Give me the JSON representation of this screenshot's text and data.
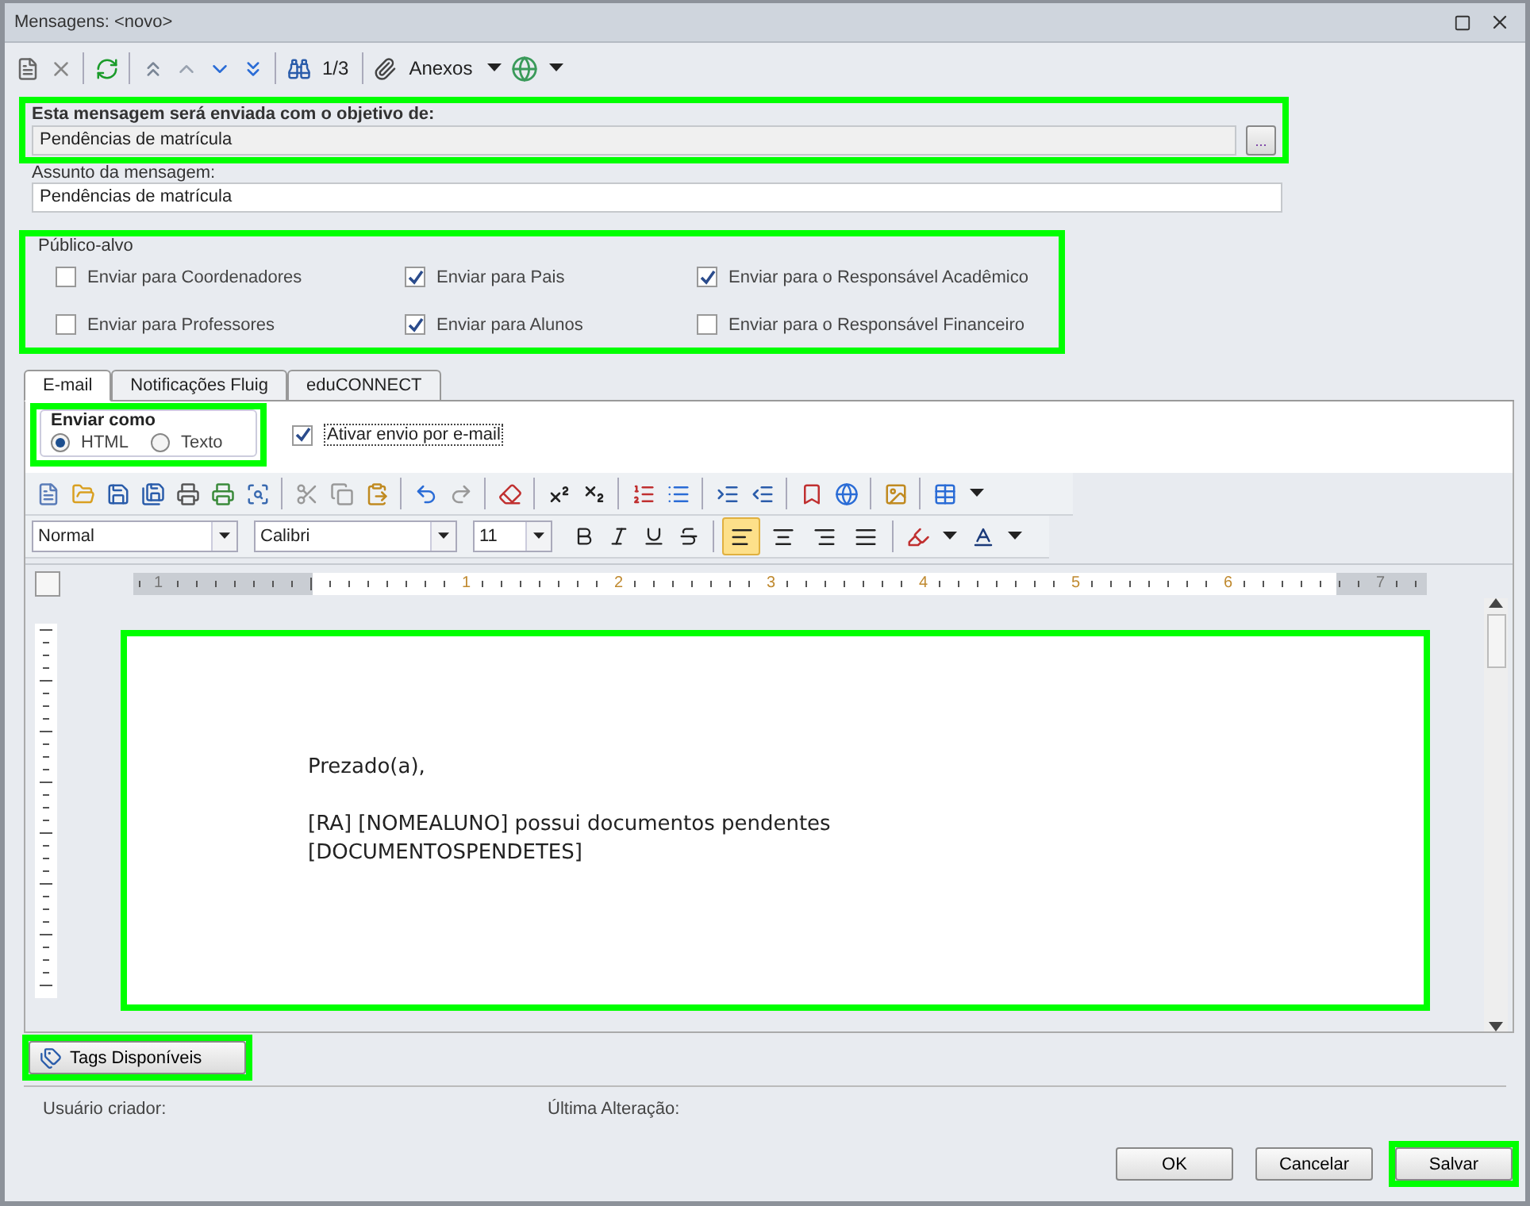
{
  "window": {
    "title": "Mensagens: <novo>"
  },
  "toolbar": {
    "record_position": "1/3",
    "attachments_label": "Anexos"
  },
  "purpose": {
    "highlighted": true,
    "label": "Esta mensagem será enviada com o objetivo de:",
    "value": "Pendências de matrícula",
    "browse_label": "..."
  },
  "subject": {
    "label": "Assunto da mensagem:",
    "value": "Pendências de matrícula"
  },
  "audience": {
    "highlighted": true,
    "title": "Público-alvo",
    "options": [
      {
        "label": "Enviar para Coordenadores",
        "checked": false
      },
      {
        "label": "Enviar para Pais",
        "checked": true
      },
      {
        "label": "Enviar para o Responsável Acadêmico",
        "checked": true
      },
      {
        "label": "Enviar para Professores",
        "checked": false
      },
      {
        "label": "Enviar para Alunos",
        "checked": true
      },
      {
        "label": "Enviar para o Responsável Financeiro",
        "checked": false
      }
    ]
  },
  "tabs": [
    {
      "label": "E-mail",
      "selected": true
    },
    {
      "label": "Notificações Fluig",
      "selected": false
    },
    {
      "label": "eduCONNECT",
      "selected": false
    }
  ],
  "send_as": {
    "highlighted": true,
    "title": "Enviar como",
    "options": [
      {
        "label": "HTML",
        "selected": true
      },
      {
        "label": "Texto",
        "selected": false
      }
    ]
  },
  "enable_email": {
    "label": "Ativar envio por e-mail",
    "checked": true
  },
  "editor": {
    "style": "Normal",
    "font": "Calibri",
    "size": "11",
    "alignment": [
      {
        "kind": "left",
        "selected": true
      },
      {
        "kind": "center",
        "selected": false
      },
      {
        "kind": "right",
        "selected": false
      },
      {
        "kind": "justify",
        "selected": false
      }
    ],
    "ruler_labels": [
      {
        "label": "1",
        "margin": true
      },
      {
        "label": "1",
        "margin": false
      },
      {
        "label": "2",
        "margin": false
      },
      {
        "label": "3",
        "margin": false
      },
      {
        "label": "4",
        "margin": false
      },
      {
        "label": "5",
        "margin": false
      },
      {
        "label": "6",
        "margin": false
      },
      {
        "label": "7",
        "margin": true
      }
    ],
    "highlighted": true,
    "paragraphs": [
      [
        "Prezado(a),"
      ],
      [
        "[RA] [NOMEALUNO] possui documentos pendentes",
        "[DOCUMENTOSPENDETES]"
      ]
    ]
  },
  "tags_button": {
    "label": "Tags Disponíveis",
    "highlighted": true
  },
  "footer": {
    "created_by_label": "Usuário criador:",
    "last_change_label": "Última Alteração:"
  },
  "buttons": [
    {
      "label": "OK",
      "highlighted": false
    },
    {
      "label": "Cancelar",
      "highlighted": false
    },
    {
      "label": "Salvar",
      "highlighted": true
    }
  ]
}
